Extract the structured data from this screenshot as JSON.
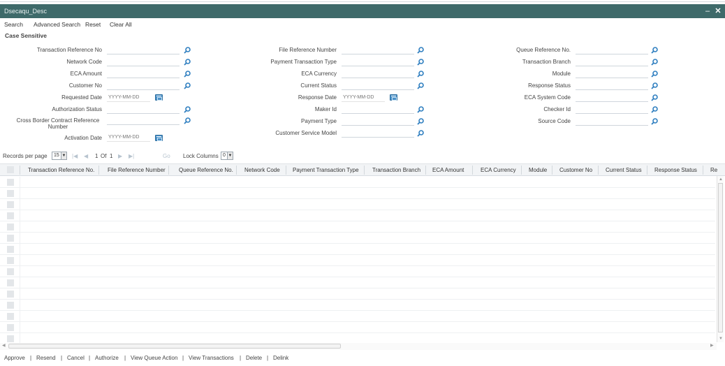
{
  "window": {
    "title": "Dsecaqu_Desc",
    "minimize_glyph": "–",
    "close_glyph": "✕"
  },
  "toolbar": {
    "search": "Search",
    "advanced_search": "Advanced Search",
    "reset": "Reset",
    "clear_all": "Clear All"
  },
  "section_label": "Case Sensitive",
  "fields": {
    "transaction_reference_no": "Transaction Reference No",
    "network_code": "Network Code",
    "eca_amount": "ECA Amount",
    "customer_no": "Customer No",
    "requested_date": "Requested Date",
    "authorization_status": "Authorization Status",
    "cross_border_contract_reference_number": "Cross Border Contract Reference Number",
    "activation_date": "Activation Date",
    "file_reference_number": "File Reference Number",
    "payment_transaction_type": "Payment Transaction Type",
    "eca_currency": "ECA Currency",
    "current_status": "Current Status",
    "response_date": "Response Date",
    "maker_id": "Maker Id",
    "payment_type": "Payment Type",
    "customer_service_model": "Customer Service Model",
    "queue_reference_no": "Queue Reference No.",
    "transaction_branch": "Transaction Branch",
    "module": "Module",
    "response_status": "Response Status",
    "eca_system_code": "ECA System Code",
    "checker_id": "Checker Id",
    "source_code": "Source Code"
  },
  "date_placeholder": "YYYY-MM-DD",
  "pager": {
    "records_per_page_label": "Records per page",
    "records_per_page_value": "15",
    "first": "|◀",
    "prev": "◀",
    "page_current": "1",
    "of_label": "Of",
    "page_total": "1",
    "next": "▶",
    "last": "▶|",
    "go": "Go",
    "lock_columns_label": "Lock Columns",
    "lock_columns_value": "0"
  },
  "grid": {
    "columns": [
      "Transaction Reference No.",
      "File Reference Number",
      "Queue Reference No.",
      "Network Code",
      "Payment Transaction Type",
      "Transaction Branch",
      "ECA Amount",
      "ECA Currency",
      "Module",
      "Customer No",
      "Current Status",
      "Response Status",
      "Re"
    ],
    "row_count": 15
  },
  "actions": {
    "approve": "Approve",
    "resend": "Resend",
    "cancel": "Cancel",
    "authorize": "Authorize",
    "view_queue_action": "View Queue Action",
    "view_transactions": "View Transactions",
    "delete": "Delete",
    "delink": "Delink",
    "separator": "|"
  },
  "colors": {
    "titlebar": "#3e6a6a",
    "lookup_icon": "#2f7fc0",
    "calendar_icon": "#4a90c8"
  }
}
